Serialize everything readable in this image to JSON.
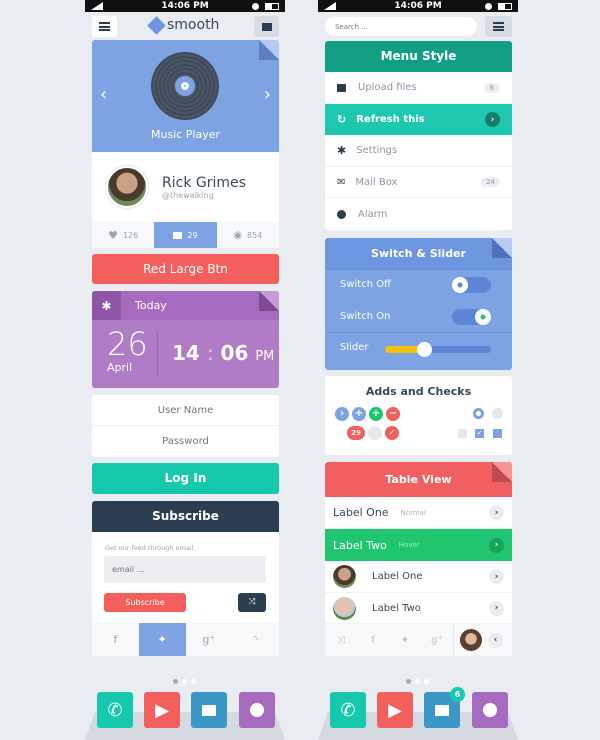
{
  "status": {
    "time": "14:06 PM"
  },
  "left": {
    "logo": "smooth",
    "music": {
      "title": "Music Player"
    },
    "profile": {
      "name": "Rick Grimes",
      "handle": "@thewalking",
      "likes": "126",
      "comments": "29",
      "views": "854"
    },
    "red_button": "Red Large Btn",
    "today": {
      "title": "Today",
      "day": "26",
      "month": "April",
      "hour": "14",
      "minute": "06",
      "ampm": "PM"
    },
    "login": {
      "username_placeholder": "User Name",
      "password_placeholder": "Password",
      "button": "Log In"
    },
    "subscribe": {
      "title": "Subscribe",
      "text": "Get our feed through email.",
      "email_placeholder": "email ...",
      "button": "Subscribe"
    }
  },
  "right": {
    "search_placeholder": "Search ...",
    "menu": {
      "title": "Menu Style",
      "items": [
        {
          "label": "Upload files",
          "badge": "8",
          "icon": "comment-icon"
        },
        {
          "label": "Refresh this",
          "icon": "refresh-icon"
        },
        {
          "label": "Settings",
          "icon": "gear-icon"
        },
        {
          "label": "Mail Box",
          "badge": "24",
          "icon": "mail-icon"
        },
        {
          "label": "Alarm",
          "icon": "clock-icon"
        }
      ]
    },
    "switch": {
      "title": "Switch & Slider",
      "off_label": "Switch Off",
      "on_label": "Switch On",
      "slider_label": "Slider",
      "slider_value": 0.3
    },
    "adds": {
      "title": "Adds and Checks",
      "badge": "29"
    },
    "table": {
      "title": "Table View",
      "rows": [
        {
          "label": "Label One",
          "sub": "Normal"
        },
        {
          "label": "Label Two",
          "sub": "Hover"
        },
        {
          "label": "Label One"
        },
        {
          "label": "Label Two"
        }
      ]
    }
  },
  "dock": {
    "badge": "6"
  },
  "colors": {
    "blue": "#7ea3e2",
    "purple": "#a66bbe",
    "teal": "#16c8ac",
    "red": "#f25f5c",
    "dark": "#2b3e50",
    "green": "#1fc56f"
  }
}
